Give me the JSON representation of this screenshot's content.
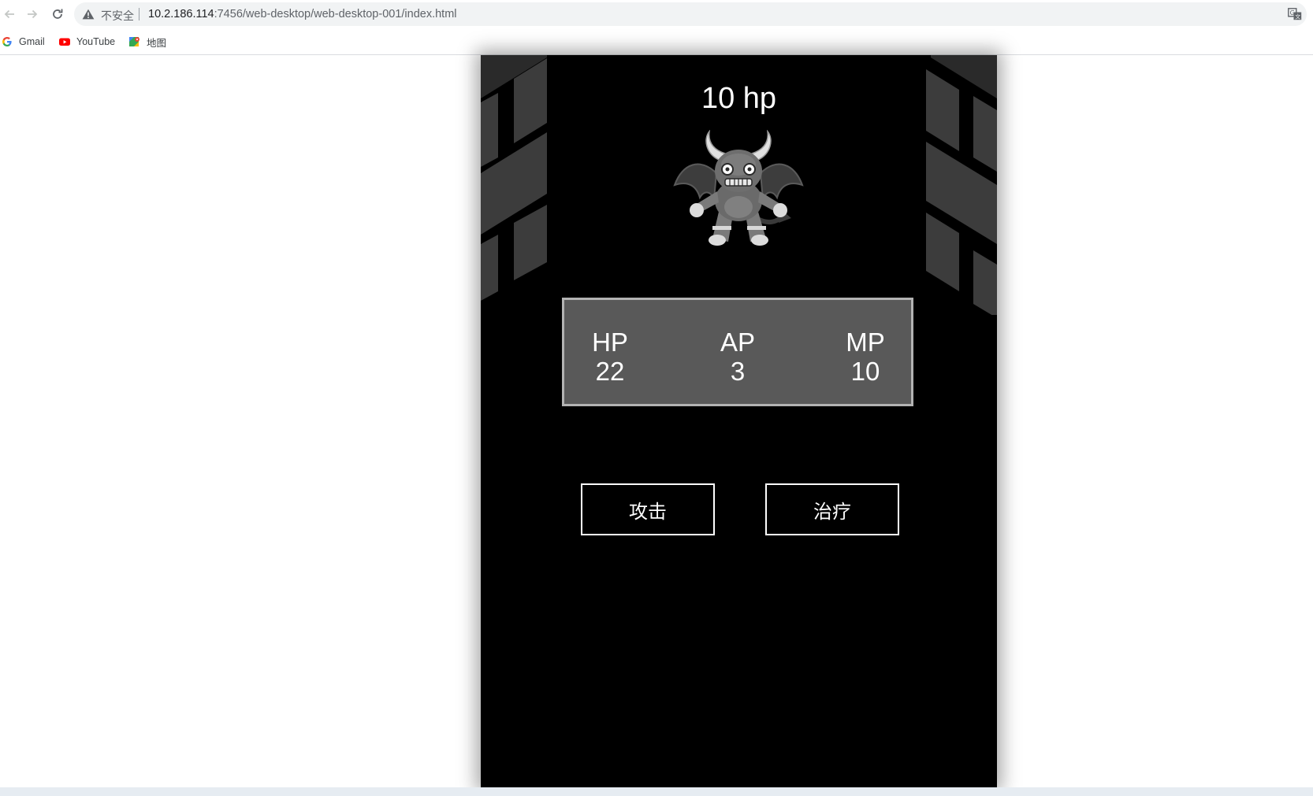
{
  "browser": {
    "security_label": "不安全",
    "url_host": "10.2.186.114",
    "url_rest": ":7456/web-desktop/web-desktop-001/index.html",
    "bookmarks": [
      {
        "label": "Gmail",
        "icon": "google-icon"
      },
      {
        "label": "YouTube",
        "icon": "youtube-icon"
      },
      {
        "label": "地图",
        "icon": "maps-icon"
      }
    ]
  },
  "game": {
    "enemy_hp_text": "10 hp",
    "enemy_icon": "devil-icon",
    "stats": [
      {
        "label": "HP",
        "value": "22"
      },
      {
        "label": "AP",
        "value": "3"
      },
      {
        "label": "MP",
        "value": "10"
      }
    ],
    "actions": {
      "attack_label": "攻击",
      "heal_label": "治疗"
    }
  },
  "colors": {
    "game_background": "#000000",
    "panel_background": "#595959",
    "panel_border": "#b3b3b3",
    "text": "#ffffff"
  }
}
